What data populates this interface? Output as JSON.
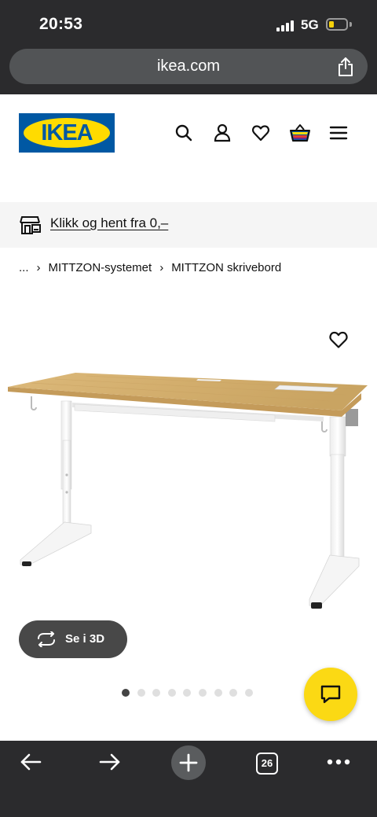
{
  "status_bar": {
    "time": "20:53",
    "network": "5G"
  },
  "browser": {
    "url": "ikea.com",
    "tab_count": "26"
  },
  "header": {
    "logo_text": "IKEA"
  },
  "promo": {
    "text": "Klikk og hent fra 0,–"
  },
  "breadcrumb": {
    "ellipsis": "...",
    "items": [
      "MITTZON-systemet",
      "MITTZON skrivebord"
    ]
  },
  "product": {
    "view_3d_label": "Se i 3D",
    "image_count": 9,
    "active_image": 1
  },
  "colors": {
    "brand_blue": "#0058a3",
    "brand_yellow": "#ffdb00",
    "chat_yellow": "#fbd914",
    "chrome_dark": "#2b2b2d"
  },
  "icons": [
    "share-icon",
    "search-icon",
    "account-icon",
    "wishlist-icon",
    "cart-icon",
    "menu-icon",
    "store-pickup-icon",
    "heart-icon",
    "rotate-3d-icon",
    "chat-icon",
    "back-icon",
    "forward-icon",
    "new-tab-icon",
    "more-icon"
  ]
}
